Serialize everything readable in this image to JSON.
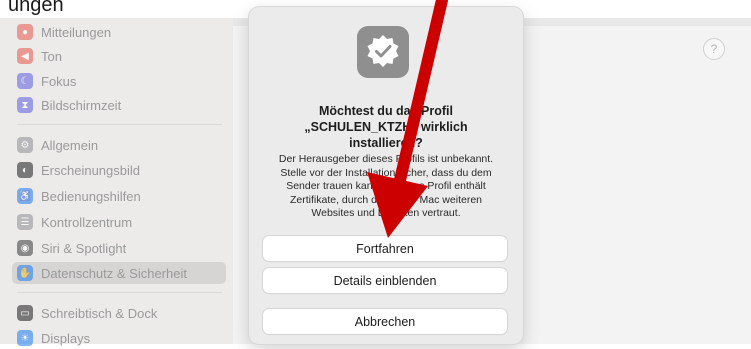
{
  "caption": {
    "text": "ungen"
  },
  "sidebar": {
    "items": [
      {
        "label": "Mitteilungen",
        "icon": "bell-icon",
        "color": "#e8574b"
      },
      {
        "label": "Ton",
        "icon": "speaker-icon",
        "color": "#e8574b"
      },
      {
        "label": "Fokus",
        "icon": "moon-icon",
        "color": "#5b5ce2"
      },
      {
        "label": "Bildschirmzeit",
        "icon": "hourglass-icon",
        "color": "#5b5ce2"
      },
      {
        "label": "Allgemein",
        "icon": "gear-icon",
        "color": "#8e8e93"
      },
      {
        "label": "Erscheinungsbild",
        "icon": "appearance-icon",
        "color": "#1c1c1e"
      },
      {
        "label": "Bedienungshilfen",
        "icon": "accessibility-icon",
        "color": "#1e7cf2"
      },
      {
        "label": "Kontrollzentrum",
        "icon": "control-center-icon",
        "color": "#8e8e93"
      },
      {
        "label": "Siri & Spotlight",
        "icon": "siri-icon",
        "color": "#3a3a3c"
      },
      {
        "label": "Datenschutz & Sicherheit",
        "icon": "hand-icon",
        "color": "#1e7cf2"
      },
      {
        "label": "Schreibtisch & Dock",
        "icon": "dock-icon",
        "color": "#1c1c1e"
      },
      {
        "label": "Displays",
        "icon": "sun-icon",
        "color": "#1e7cf2"
      }
    ]
  },
  "main": {
    "help_label": "?"
  },
  "dialog": {
    "icon": "verified-badge-icon",
    "title_line1": "Möchtest du das Profil",
    "title_line2": "„SCHULEN_KTZH“ wirklich",
    "title_line3": "installieren?",
    "body_line1": "Der Herausgeber dieses Profils ist unbekannt.",
    "body_line2": "Stelle vor der Installation sicher, dass du dem",
    "body_line3": "Sender trauen kannst. Dieses Profil enthält",
    "body_line4": "Zertifikate, durch die dieser Mac weiteren",
    "body_line5": "Websites und Diensten vertraut.",
    "buttons": {
      "continue": "Fortfahren",
      "details": "Details einblenden",
      "cancel": "Abbrechen"
    }
  },
  "annotation": {
    "arrow_color": "#cc0000"
  }
}
